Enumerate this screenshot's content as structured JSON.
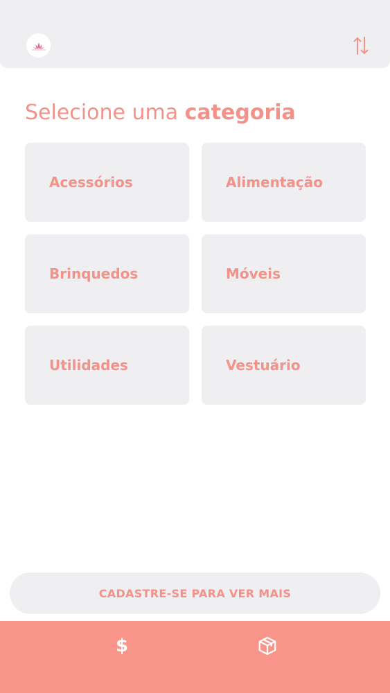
{
  "header": {
    "logo_icon": "flower-logo-icon",
    "sort_icon": "sort-arrows-icon"
  },
  "title": {
    "regular": "Selecione uma ",
    "bold": "categoria"
  },
  "categories": [
    {
      "label": "Acessórios"
    },
    {
      "label": "Alimentação"
    },
    {
      "label": "Brinquedos"
    },
    {
      "label": "Móveis"
    },
    {
      "label": "Utilidades"
    },
    {
      "label": "Vestuário"
    }
  ],
  "register_button": {
    "label": "CADASTRE-SE PARA VER MAIS"
  },
  "bottom_nav": {
    "price_symbol": "$",
    "price_icon": "dollar-icon",
    "box_icon": "package-icon"
  },
  "colors": {
    "accent": "#f39289",
    "nav_background": "#f9948b",
    "card_background": "#efeef0"
  }
}
